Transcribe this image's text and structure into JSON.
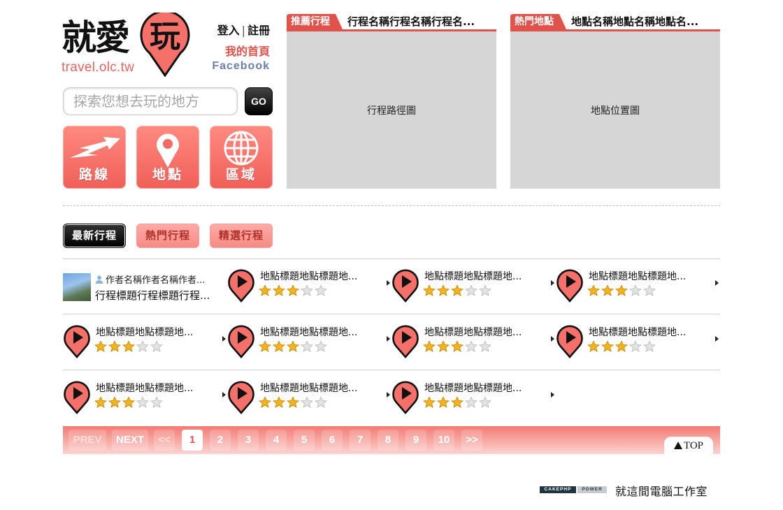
{
  "brand": {
    "logo_text": "就愛",
    "logo_pin_char": "玩",
    "url": "travel.olc.tw",
    "accent_color": "#e0534b"
  },
  "user_links": {
    "login": "登入",
    "register": "註冊",
    "my_home": "我的首頁",
    "facebook": "Facebook"
  },
  "search": {
    "placeholder": "探索您想去玩的地方",
    "value": "",
    "go_label": "GO"
  },
  "nav": {
    "route_label": "路線",
    "place_label": "地點",
    "region_label": "區域"
  },
  "featured": {
    "trip": {
      "tag": "推薦行程",
      "title": "行程名稱行程名稱行程名...",
      "map_label": "行程路徑圖"
    },
    "place": {
      "tag": "熱門地點",
      "title": "地點名稱地點名稱地點名...",
      "map_label": "地點位置圖"
    }
  },
  "tabs": {
    "latest": "最新行程",
    "popular": "熱門行程",
    "selected": "精選行程"
  },
  "author_item": {
    "author": "作者名稱作者名稱作者...",
    "title": "行程標題行程標題行程..."
  },
  "items": [
    {
      "title": "地點標題地點標題地...",
      "rating": 3
    },
    {
      "title": "地點標題地點標題地...",
      "rating": 3
    },
    {
      "title": "地點標題地點標題地...",
      "rating": 3
    },
    {
      "title": "地點標題地點標題地...",
      "rating": 3
    },
    {
      "title": "地點標題地點標題地...",
      "rating": 3
    },
    {
      "title": "地點標題地點標題地...",
      "rating": 3
    },
    {
      "title": "地點標題地點標題地...",
      "rating": 3
    },
    {
      "title": "地點標題地點標題地...",
      "rating": 3
    },
    {
      "title": "地點標題地點標題地...",
      "rating": 3
    },
    {
      "title": "地點標題地點標題地...",
      "rating": 3
    }
  ],
  "rating_max": 5,
  "pagination": {
    "prev": "PREV",
    "next": "NEXT",
    "first": "<<",
    "last": ">>",
    "pages": [
      "1",
      "2",
      "3",
      "4",
      "5",
      "6",
      "7",
      "8",
      "9",
      "10"
    ],
    "current": "1",
    "top_label": "TOP"
  },
  "footer": {
    "badge_left": "CAKEPHP",
    "badge_right": "POWER",
    "studio": "就這間電腦工作室"
  }
}
